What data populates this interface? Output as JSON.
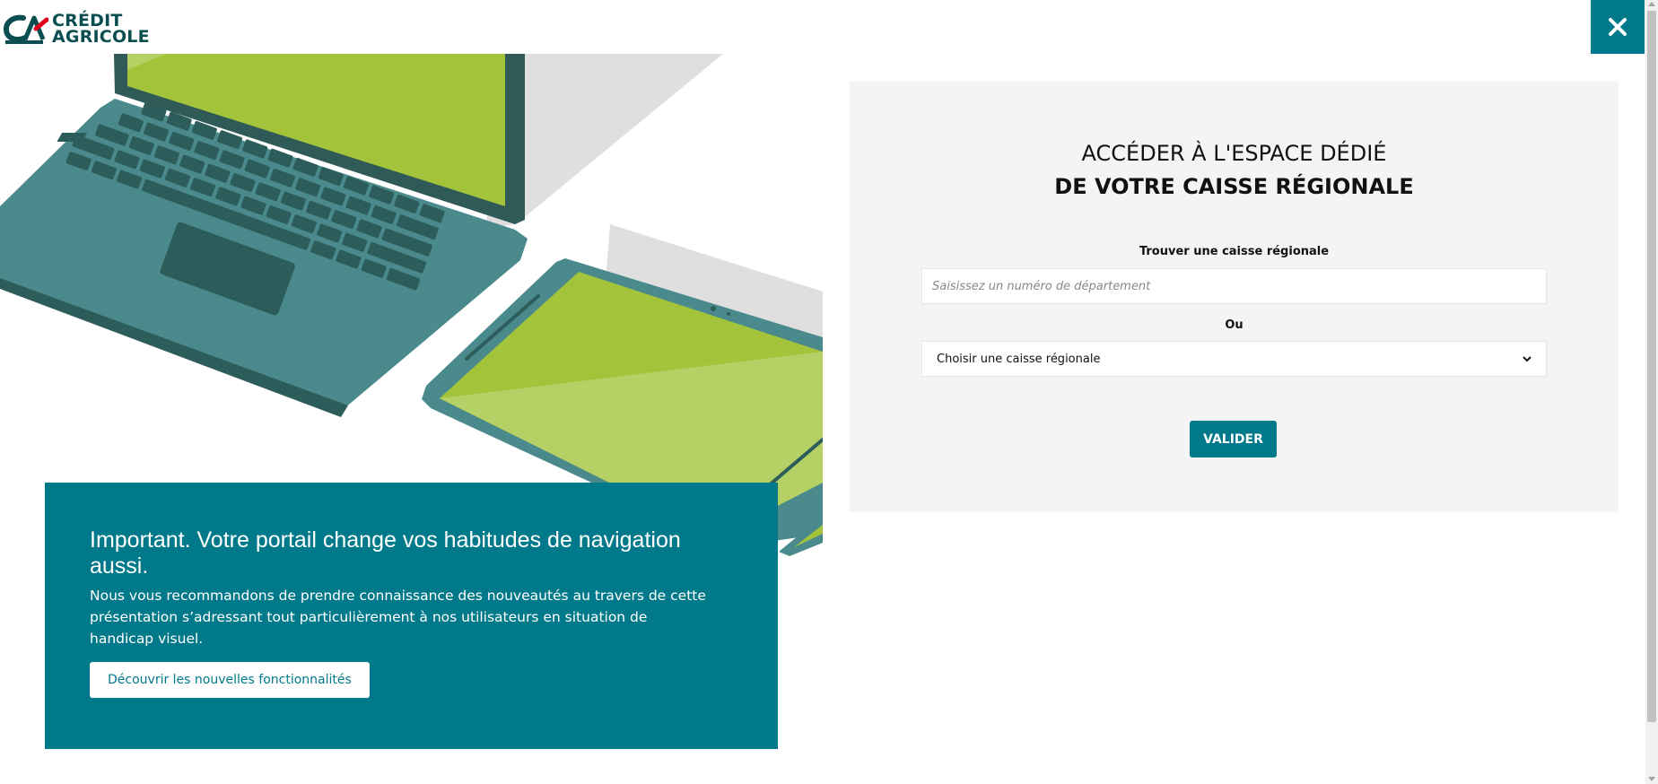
{
  "brand": {
    "logo_line1": "CRÉDIT",
    "logo_line2": "AGRICOLE",
    "primary_color": "#00798a",
    "logo_color": "#0b4e52"
  },
  "header": {
    "close_icon": "close-icon"
  },
  "info": {
    "title": "Important. Votre portail change vos habitudes de navigation aussi.",
    "text": "Nous vous recommandons de prendre connaissance des nouveautés au travers de cette présentation s’adressant tout particulièrement à nos utilisateurs en situation de handicap visuel.",
    "button_label": "Découvrir les nouvelles fonctionnalités"
  },
  "panel": {
    "heading_line1": "ACCÉDER À L'ESPACE DÉDIÉ",
    "heading_line2": "DE VOTRE CAISSE RÉGIONALE",
    "find_label": "Trouver une caisse régionale",
    "dept_input_value": "",
    "dept_input_placeholder": "Saisissez un numéro de département",
    "or_label": "Ou",
    "select_value": "Choisir une caisse régionale",
    "validate_label": "VALIDER"
  }
}
